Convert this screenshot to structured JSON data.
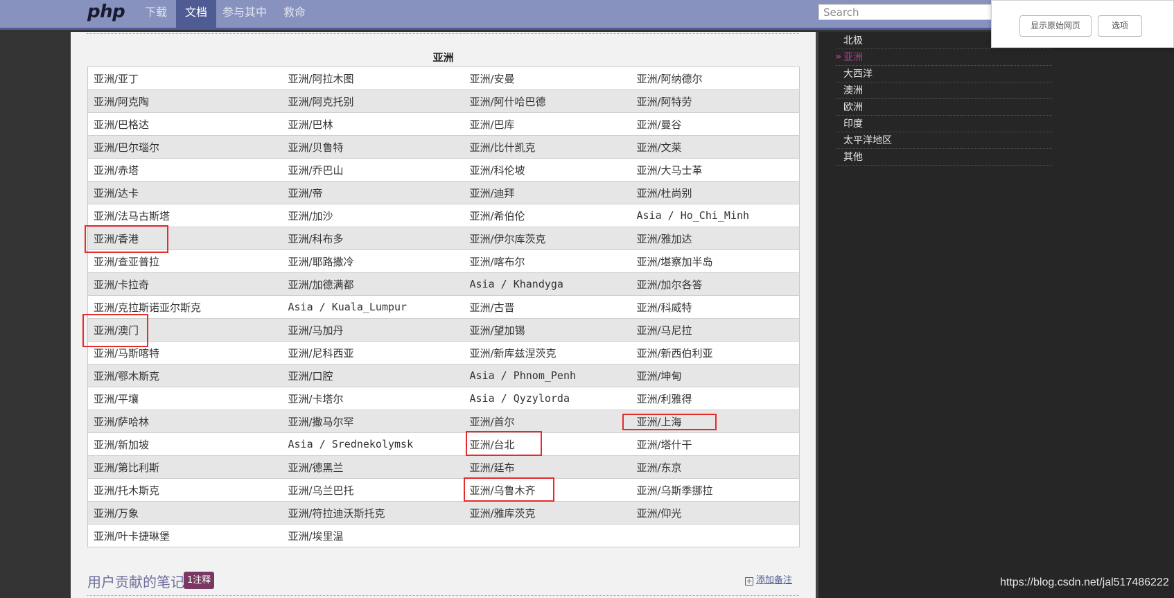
{
  "nav": {
    "logo": "php",
    "links": [
      "下载",
      "文档",
      "参与其中",
      "救命"
    ],
    "active_index": 1,
    "search_placeholder": "Search"
  },
  "popup": {
    "show_original": "显示原始网页",
    "options": "选项"
  },
  "sidebar": {
    "items": [
      "北极",
      "亚洲",
      "大西洋",
      "澳洲",
      "欧洲",
      "印度",
      "太平洋地区",
      "其他"
    ],
    "current_index": 1
  },
  "table": {
    "title": "亚洲",
    "rows": [
      [
        "亚洲/亚丁",
        "亚洲/阿拉木图",
        "亚洲/安曼",
        "亚洲/阿纳德尔"
      ],
      [
        "亚洲/阿克陶",
        "亚洲/阿克托别",
        "亚洲/阿什哈巴德",
        "亚洲/阿特劳"
      ],
      [
        "亚洲/巴格达",
        "亚洲/巴林",
        "亚洲/巴库",
        "亚洲/曼谷"
      ],
      [
        "亚洲/巴尔瑙尔",
        "亚洲/贝鲁特",
        "亚洲/比什凯克",
        "亚洲/文莱"
      ],
      [
        "亚洲/赤塔",
        "亚洲/乔巴山",
        "亚洲/科伦坡",
        "亚洲/大马士革"
      ],
      [
        "亚洲/达卡",
        "亚洲/帝",
        "亚洲/迪拜",
        "亚洲/杜尚别"
      ],
      [
        "亚洲/法马古斯塔",
        "亚洲/加沙",
        "亚洲/希伯伦",
        "Asia / Ho_Chi_Minh"
      ],
      [
        "亚洲/香港",
        "亚洲/科布多",
        "亚洲/伊尔库茨克",
        "亚洲/雅加达"
      ],
      [
        "亚洲/查亚普拉",
        "亚洲/耶路撒冷",
        "亚洲/喀布尔",
        "亚洲/堪察加半岛"
      ],
      [
        "亚洲/卡拉奇",
        "亚洲/加德满都",
        "Asia / Khandyga",
        "亚洲/加尔各答"
      ],
      [
        "亚洲/克拉斯诺亚尔斯克",
        "Asia / Kuala_Lumpur",
        "亚洲/古晋",
        "亚洲/科威特"
      ],
      [
        "亚洲/澳门",
        "亚洲/马加丹",
        "亚洲/望加锡",
        "亚洲/马尼拉"
      ],
      [
        "亚洲/马斯喀特",
        "亚洲/尼科西亚",
        "亚洲/新库兹涅茨克",
        "亚洲/新西伯利亚"
      ],
      [
        "亚洲/鄂木斯克",
        "亚洲/口腔",
        "Asia / Phnom_Penh",
        "亚洲/坤甸"
      ],
      [
        "亚洲/平壤",
        "亚洲/卡塔尔",
        "Asia / Qyzylorda",
        "亚洲/利雅得"
      ],
      [
        "亚洲/萨哈林",
        "亚洲/撒马尔罕",
        "亚洲/首尔",
        "亚洲/上海"
      ],
      [
        "亚洲/新加坡",
        "Asia / Srednekolymsk",
        "亚洲/台北",
        "亚洲/塔什干"
      ],
      [
        "亚洲/第比利斯",
        "亚洲/德黑兰",
        "亚洲/廷布",
        "亚洲/东京"
      ],
      [
        "亚洲/托木斯克",
        "亚洲/乌兰巴托",
        "亚洲/乌鲁木齐",
        "亚洲/乌斯季挪拉"
      ],
      [
        "亚洲/万象",
        "亚洲/符拉迪沃斯托克",
        "亚洲/雅库茨克",
        "亚洲/仰光"
      ],
      [
        "亚洲/叶卡捷琳堡",
        "亚洲/埃里温",
        "",
        ""
      ]
    ]
  },
  "notes": {
    "title": "用户贡献的笔记",
    "badge": "1注释",
    "add_note": "添加备注"
  },
  "watermark": "https://blog.csdn.net/jal517486222",
  "colors": {
    "nav_bg": "#8892bf",
    "nav_active": "#4f5b93",
    "highlight_box": "#e62b2b",
    "sidebar_current": "#a9418a",
    "badge_bg": "#793862"
  }
}
